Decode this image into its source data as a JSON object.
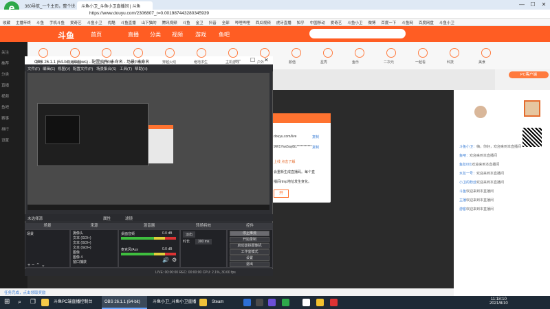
{
  "browser": {
    "tabs": [
      "360导航_一个主页，整个世界",
      "斗鱼小卫_斗鱼小卫直播间 | 斗鱼"
    ],
    "url": "https://www.douyu.com/2306807_r=0.001987443280345939",
    "bookmarks": [
      "收藏",
      "主播年终",
      "斗鱼",
      "手机斗鱼",
      "爱奇艺",
      "斗鱼小卫",
      "优酷",
      "斗鱼直播",
      "山下猫的",
      "腾讯视频",
      "斗鱼",
      "金卫",
      "抖音",
      "全部",
      "哔哩哔哩",
      "西瓜视频",
      "虎牙直播",
      "知乎",
      "中国移动",
      "爱奇艺",
      "斗鱼小卫",
      "微博",
      "百度一下",
      "斗鱼网",
      "百度网盘",
      "斗鱼小卫"
    ],
    "window_controls": [
      "—",
      "☐",
      "✕"
    ]
  },
  "site": {
    "logo": "斗鱼",
    "nav": [
      "首页",
      "直播",
      "分类",
      "视频",
      "游戏",
      "鱼吧"
    ],
    "categories": [
      "推荐",
      "英雄联盟",
      "王者荣耀",
      "和平精英",
      "穿越火线",
      "绝地求生",
      "主机游戏",
      "户外",
      "颜值",
      "星秀",
      "鱼乐",
      "二次元",
      "一起看",
      "科技",
      "美食"
    ],
    "left_sidebar": [
      "关注",
      "推荐",
      "分类",
      "直播",
      "视频",
      "鱼吧",
      "赛事",
      "排行",
      "设置"
    ],
    "badge": "PC客户端",
    "chat_lines": [
      {
        "user": "斗鱼小卫：",
        "text": "嗨，你好，欢迎来到本直播间"
      },
      {
        "user": "鱼吧：",
        "text": "欢迎来到本直播间"
      },
      {
        "user": "鱼友001",
        "text": "欢迎来到本直播间"
      },
      {
        "user": "水友一号：",
        "text": "欢迎来到本直播间"
      },
      {
        "user": "小卫的粉丝",
        "text": "欢迎来到本直播间"
      },
      {
        "user": "斗鱼",
        "text": "欢迎来到本直播间"
      },
      {
        "user": "主播",
        "text": "欢迎来到本直播间"
      },
      {
        "user": "游客",
        "text": "欢迎来到本直播间"
      }
    ],
    "notify": "任务完成，点击领取奖励"
  },
  "popup": {
    "line1": "douyu.com/live",
    "copy1": "复制",
    "line2": "9W1?wx5ay8i1***********",
    "copy2": "复制",
    "line3": "上线    点击了解",
    "line4": "会重新生成直播码。每个直",
    "line5": "播间rtmp地址发生变化。",
    "button": "开"
  },
  "obs": {
    "title": "OBS 26.1.1 (64-bit, windows) - 配置文件: 未命名 - 场景: 未命名",
    "menu": [
      "文件(F)",
      "编辑(E)",
      "视图(V)",
      "配置文件(P)",
      "场景集合(S)",
      "工具(T)",
      "帮助(H)"
    ],
    "no_source": "未选择源",
    "properties": "属性",
    "filters": "滤镜",
    "panels": [
      "场景",
      "来源",
      "混音器",
      "转场特效",
      "控件"
    ],
    "scenes": [
      "场景"
    ],
    "sources": [
      "摄像头",
      "文本 (GDI+)",
      "文本 (GDI+)",
      "文本 (GDI+)",
      "图像",
      "图像 4",
      "窗口捕获"
    ],
    "mixer": [
      {
        "name": "桌面音频",
        "db": "0.0 dB"
      },
      {
        "name": "麦克风/Aux",
        "db": "0.0 dB"
      }
    ],
    "transition": {
      "name": "淡出",
      "duration_label": "时长",
      "duration": "300 ms"
    },
    "controls": [
      "停止推流",
      "开始录制",
      "启动虚拟摄像机",
      "工作室模式",
      "设置",
      "退出"
    ],
    "status": "LIVE: 00:00:00   REC: 00:00:00   CPU: 2.1%, 30.00 fps"
  },
  "taskbar": {
    "items": [
      {
        "label": "斗鱼PC端直播控制台",
        "active": false
      },
      {
        "label": "OBS 26.1.1 (64-bit)",
        "active": true
      },
      {
        "label": "斗鱼小卫_斗鱼小卫直播",
        "active": false
      },
      {
        "label": "Steam",
        "active": false
      }
    ],
    "time": "11:18:10",
    "date": "2021/8/10"
  }
}
